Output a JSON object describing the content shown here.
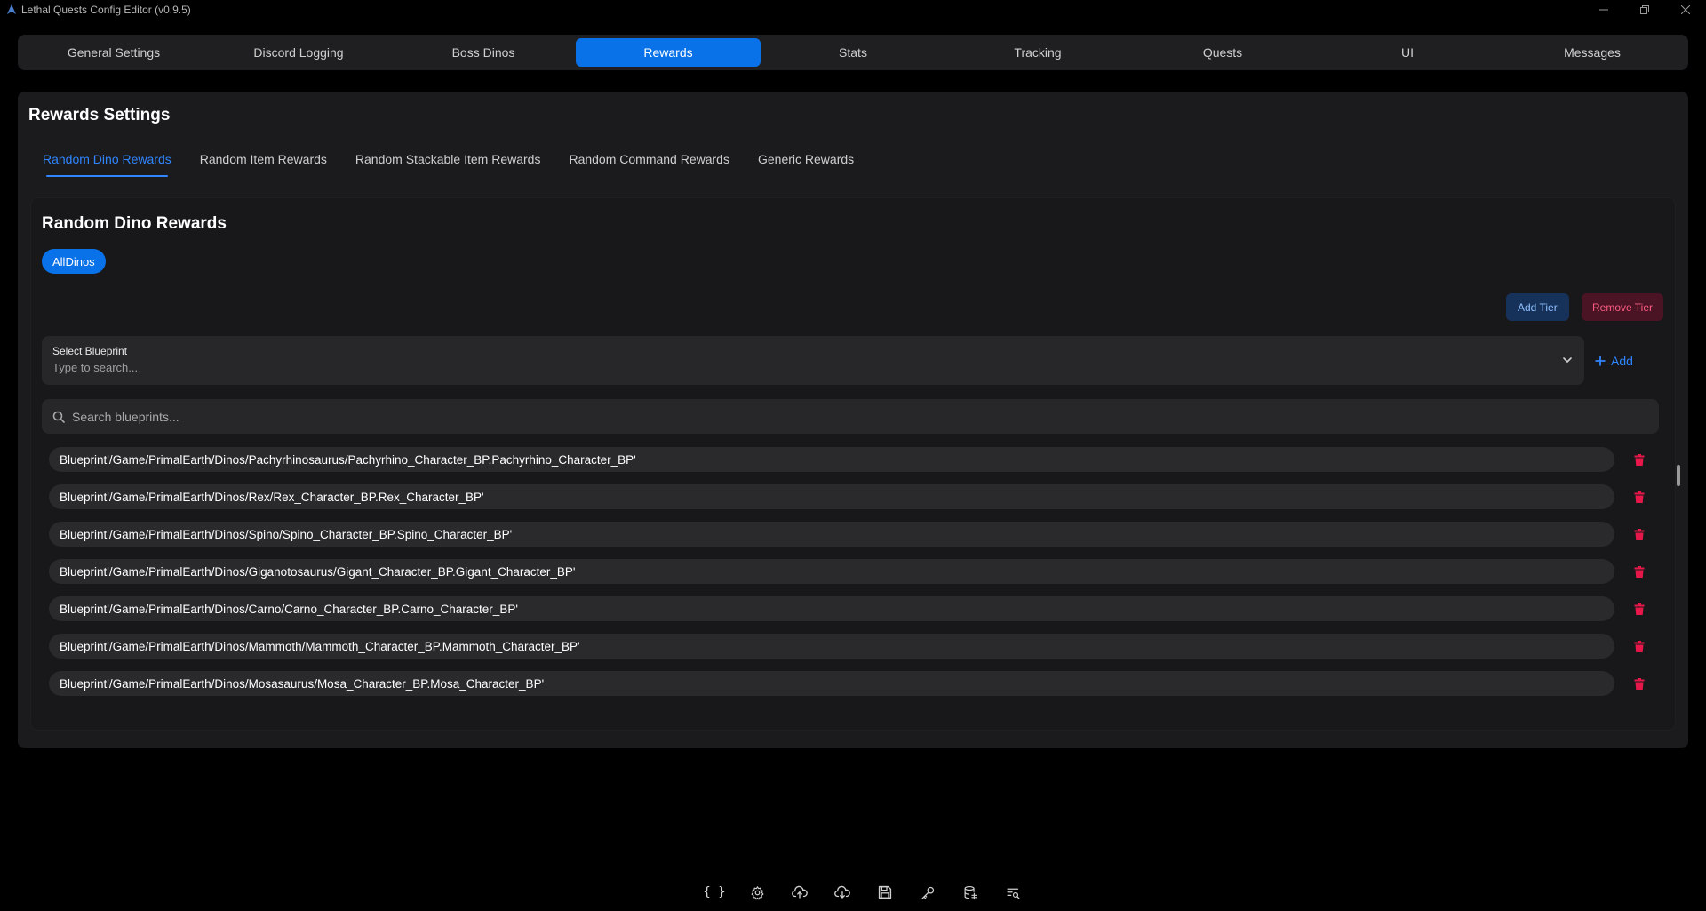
{
  "window": {
    "title": "Lethal Quests Config Editor (v0.9.5)"
  },
  "main_tabs": [
    {
      "label": "General Settings",
      "active": false
    },
    {
      "label": "Discord Logging",
      "active": false
    },
    {
      "label": "Boss Dinos",
      "active": false
    },
    {
      "label": "Rewards",
      "active": true
    },
    {
      "label": "Stats",
      "active": false
    },
    {
      "label": "Tracking",
      "active": false
    },
    {
      "label": "Quests",
      "active": false
    },
    {
      "label": "UI",
      "active": false
    },
    {
      "label": "Messages",
      "active": false
    }
  ],
  "panel": {
    "title": "Rewards Settings",
    "sub_tabs": [
      {
        "label": "Random Dino Rewards",
        "active": true
      },
      {
        "label": "Random Item Rewards",
        "active": false
      },
      {
        "label": "Random Stackable Item Rewards",
        "active": false
      },
      {
        "label": "Random Command Rewards",
        "active": false
      },
      {
        "label": "Generic Rewards",
        "active": false
      }
    ]
  },
  "section": {
    "title": "Random Dino Rewards",
    "tier_chip": "AllDinos",
    "add_tier_label": "Add Tier",
    "remove_tier_label": "Remove Tier",
    "select_label": "Select Blueprint",
    "select_placeholder": "Type to search...",
    "add_label": "Add",
    "search_placeholder": "Search blueprints..."
  },
  "blueprints": [
    "Blueprint'/Game/PrimalEarth/Dinos/Pachyrhinosaurus/Pachyrhino_Character_BP.Pachyrhino_Character_BP'",
    "Blueprint'/Game/PrimalEarth/Dinos/Rex/Rex_Character_BP.Rex_Character_BP'",
    "Blueprint'/Game/PrimalEarth/Dinos/Spino/Spino_Character_BP.Spino_Character_BP'",
    "Blueprint'/Game/PrimalEarth/Dinos/Giganotosaurus/Gigant_Character_BP.Gigant_Character_BP'",
    "Blueprint'/Game/PrimalEarth/Dinos/Carno/Carno_Character_BP.Carno_Character_BP'",
    "Blueprint'/Game/PrimalEarth/Dinos/Mammoth/Mammoth_Character_BP.Mammoth_Character_BP'",
    "Blueprint'/Game/PrimalEarth/Dinos/Mosasaurus/Mosa_Character_BP.Mosa_Character_BP'"
  ],
  "colors": {
    "accent": "#0a72e8",
    "link": "#2f86ff",
    "danger": "#e8174a",
    "background": "#000000",
    "panel": "#1b1b1e"
  },
  "toolbar_icons": [
    "braces-icon",
    "gear-icon",
    "cloud-upload-icon",
    "cloud-download-icon",
    "save-icon",
    "key-icon",
    "database-icon",
    "search-list-icon"
  ]
}
